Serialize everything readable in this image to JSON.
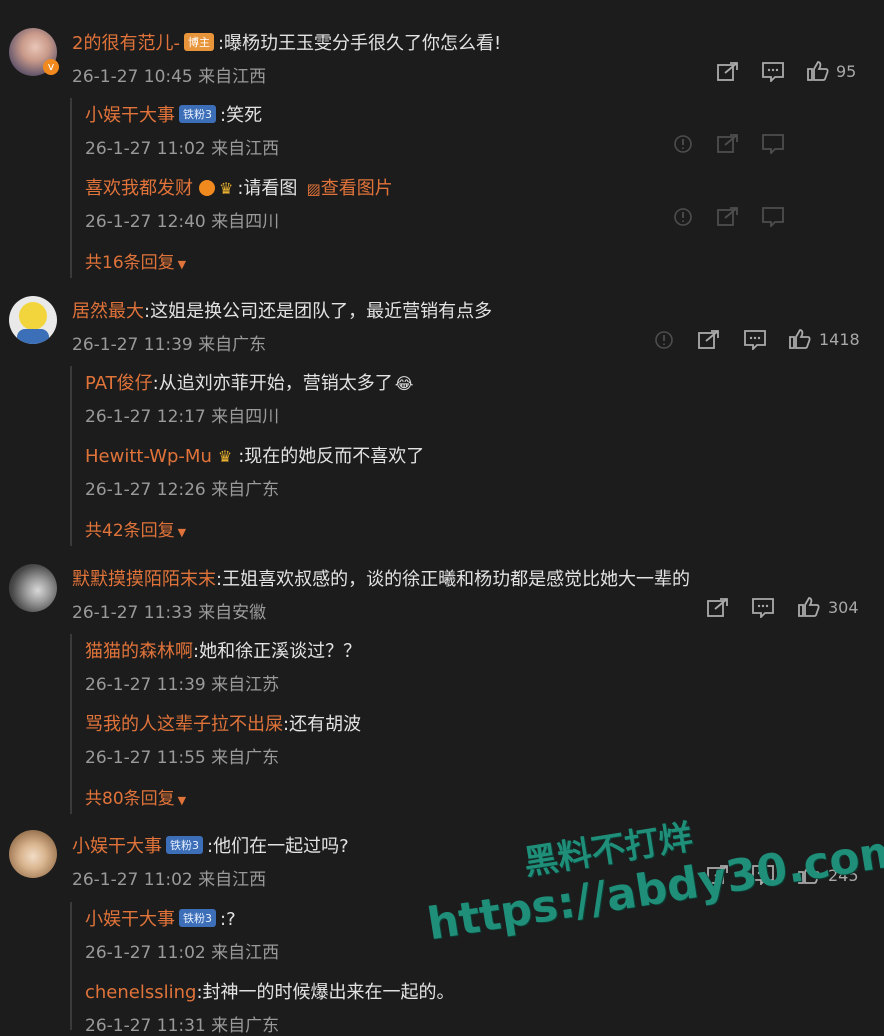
{
  "comments": [
    {
      "user": "2的很有范儿-",
      "badge": "博主",
      "text": ":曝杨玏王玉雯分手很久了你怎么看!",
      "meta": "26-1-27 10:45 来自江西",
      "likes": "95",
      "replies": [
        {
          "user": "小娱干大事",
          "badge": "铁粉3",
          "text": ":笑死",
          "meta": "26-1-27 11:02 来自江西"
        },
        {
          "user": "喜欢我都发财",
          "text": ":请看图",
          "link": "查看图片",
          "meta": "26-1-27 12:40 来自四川"
        }
      ],
      "more": "共16条回复"
    },
    {
      "user": "居然最大",
      "text": ":这姐是换公司还是团队了，最近营销有点多",
      "meta": "26-1-27 11:39 来自广东",
      "likes": "1418",
      "replies": [
        {
          "user": "PAT俊仔",
          "text": ":从追刘亦菲开始，营销太多了",
          "meta": "26-1-27 12:17 来自四川"
        },
        {
          "user": "Hewitt-Wp-Mu",
          "text": ":现在的她反而不喜欢了",
          "meta": "26-1-27 12:26 来自广东"
        }
      ],
      "more": "共42条回复"
    },
    {
      "user": "默默摸摸陌陌末末",
      "text": ":王姐喜欢叔感的，谈的徐正曦和杨玏都是感觉比她大一辈的",
      "meta": "26-1-27 11:33 来自安徽",
      "likes": "304",
      "replies": [
        {
          "user": "猫猫的森林啊",
          "text": ":她和徐正溪谈过？？",
          "meta": "26-1-27 11:39 来自江苏"
        },
        {
          "user": "骂我的人这辈子拉不出屎",
          "text": ":还有胡波",
          "meta": "26-1-27 11:55 来自广东"
        }
      ],
      "more": "共80条回复"
    },
    {
      "user": "小娱干大事",
      "badge": "铁粉3",
      "text": ":他们在一起过吗?",
      "meta": "26-1-27 11:02 来自江西",
      "likes": "245",
      "replies": [
        {
          "user": "小娱干大事",
          "badge": "铁粉3",
          "text": ":?",
          "meta": "26-1-27 11:02 来自江西"
        },
        {
          "user": "chenelssling",
          "text": ":封神一的时候爆出来在一起的。",
          "meta": "26-1-27 11:31 来自广东"
        }
      ]
    }
  ],
  "watermark": {
    "line1": "黑料不打烊",
    "line2": "https://abdy30.com"
  },
  "colors": {
    "name": "#e0733a",
    "bg": "#1c1c1c",
    "watermark": "#1f8f7a"
  }
}
